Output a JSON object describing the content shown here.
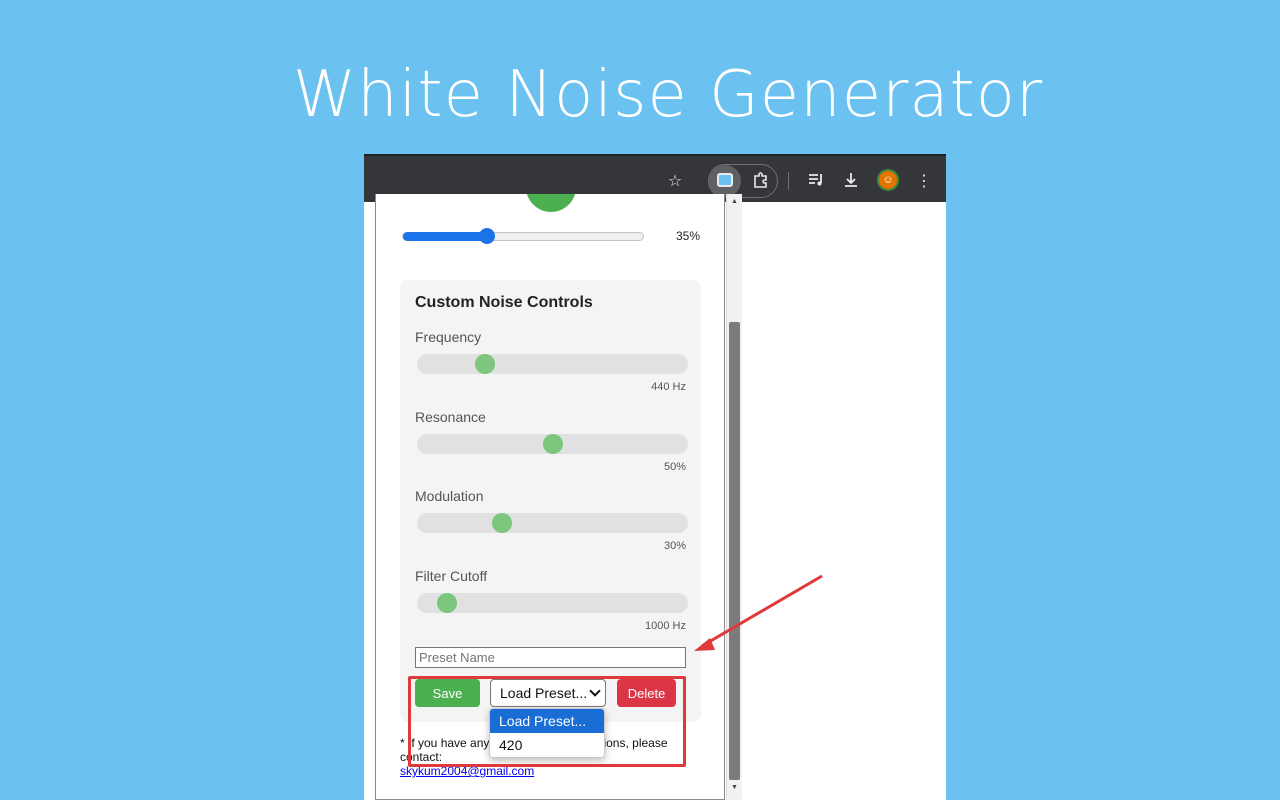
{
  "banner": {
    "title": "White Noise Generator"
  },
  "browser": {
    "toolbar": {
      "icons": [
        "bookmark-star-icon",
        "extension-active-icon",
        "extensions-puzzle-icon",
        "media-queue-icon",
        "download-icon",
        "profile-avatar",
        "menu-dots-icon"
      ]
    }
  },
  "popup": {
    "volume": {
      "value": 35,
      "label": "35%"
    },
    "custom_controls": {
      "title": "Custom Noise Controls",
      "controls": [
        {
          "label": "Frequency",
          "value_text": "440 Hz",
          "level": 0.23
        },
        {
          "label": "Resonance",
          "value_text": "50%",
          "level": 0.5
        },
        {
          "label": "Modulation",
          "value_text": "30%",
          "level": 0.3
        },
        {
          "label": "Filter Cutoff",
          "value_text": "1000 Hz",
          "level": 0.08
        }
      ],
      "preset_name_placeholder": "Preset Name",
      "save_label": "Save",
      "load_preset_selected": "Load Preset...",
      "delete_label": "Delete",
      "load_preset_options": [
        "Load Preset...",
        "420"
      ]
    },
    "footer": {
      "note": "* If you have any questions or suggestions, please contact:",
      "note_visible_start": "* If you have any",
      "note_visible_end": "s, please contact:",
      "email_visible": "skykum2004@gmail.com"
    }
  },
  "colors": {
    "background": "#6bc1ef",
    "accent_green": "#4caf50",
    "delete_red": "#dc3545",
    "slider_blue": "#1a73e8",
    "annotation_red": "#e0393b"
  }
}
